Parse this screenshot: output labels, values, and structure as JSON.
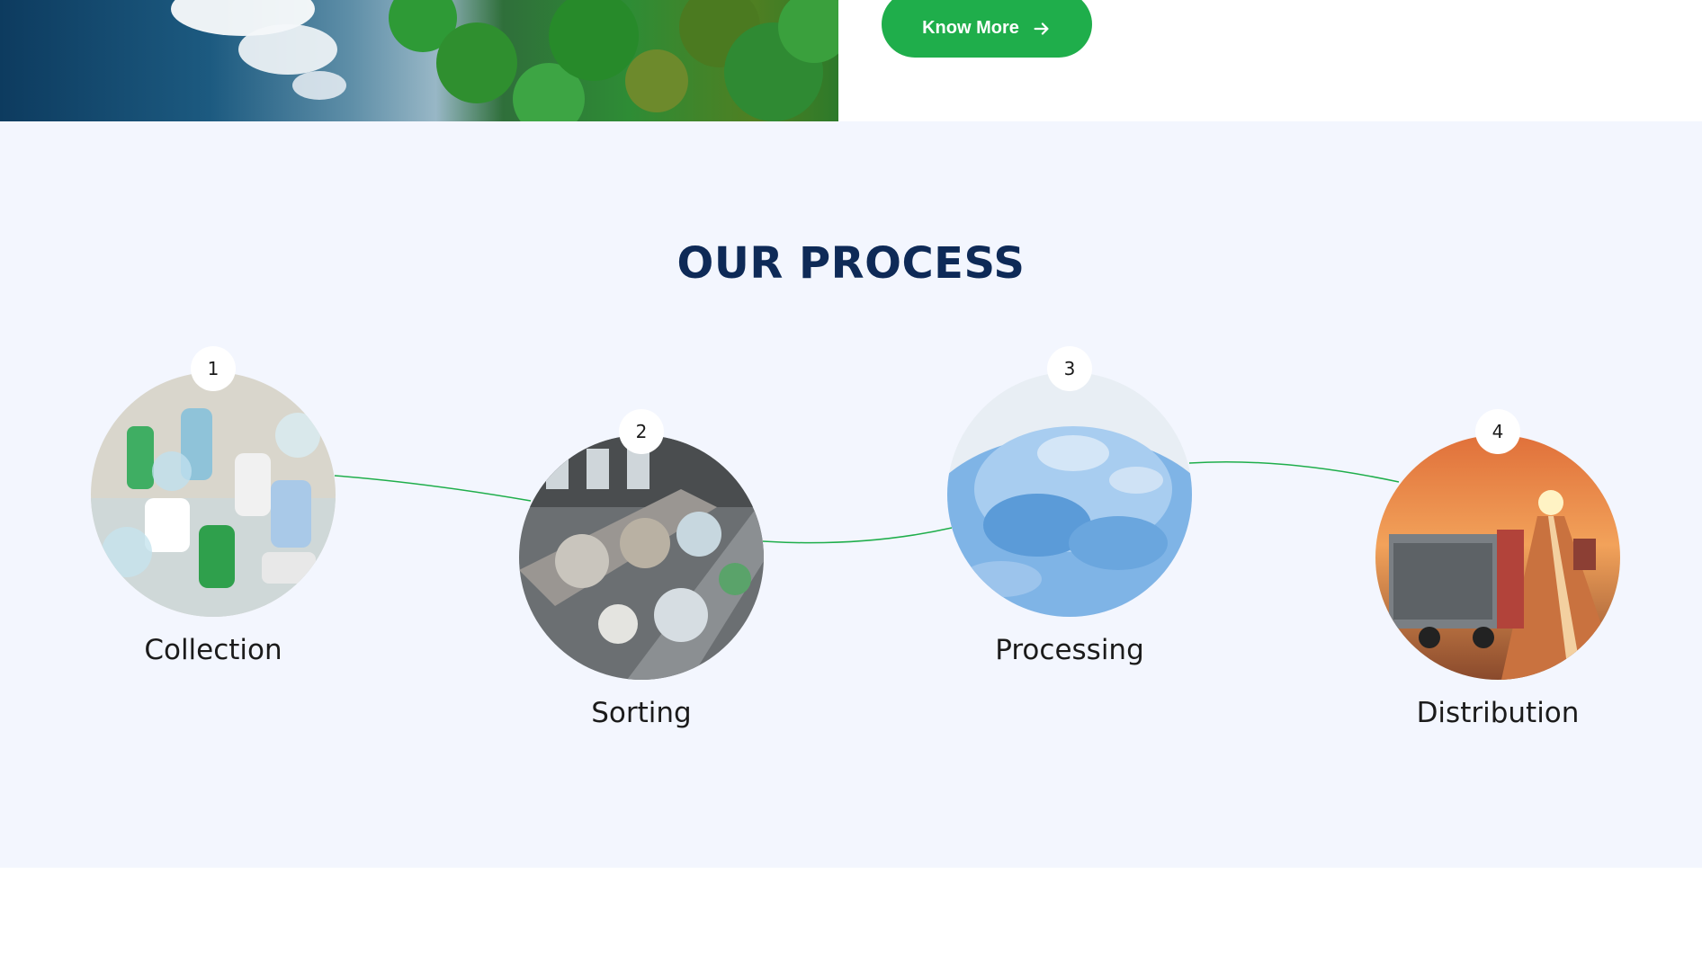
{
  "hero": {
    "know_more_label": "Know More",
    "arrow_icon": "arrow-right-icon"
  },
  "process": {
    "title": "OUR PROCESS",
    "accent_color": "#1fae4b",
    "title_color": "#0e2a57",
    "steps": [
      {
        "number": "1",
        "label": "Collection",
        "image": "plastic-bottles-pile-image"
      },
      {
        "number": "2",
        "label": "Sorting",
        "image": "sorting-conveyor-image"
      },
      {
        "number": "3",
        "label": "Processing",
        "image": "plastic-flakes-image"
      },
      {
        "number": "4",
        "label": "Distribution",
        "image": "truck-highway-image"
      }
    ]
  }
}
